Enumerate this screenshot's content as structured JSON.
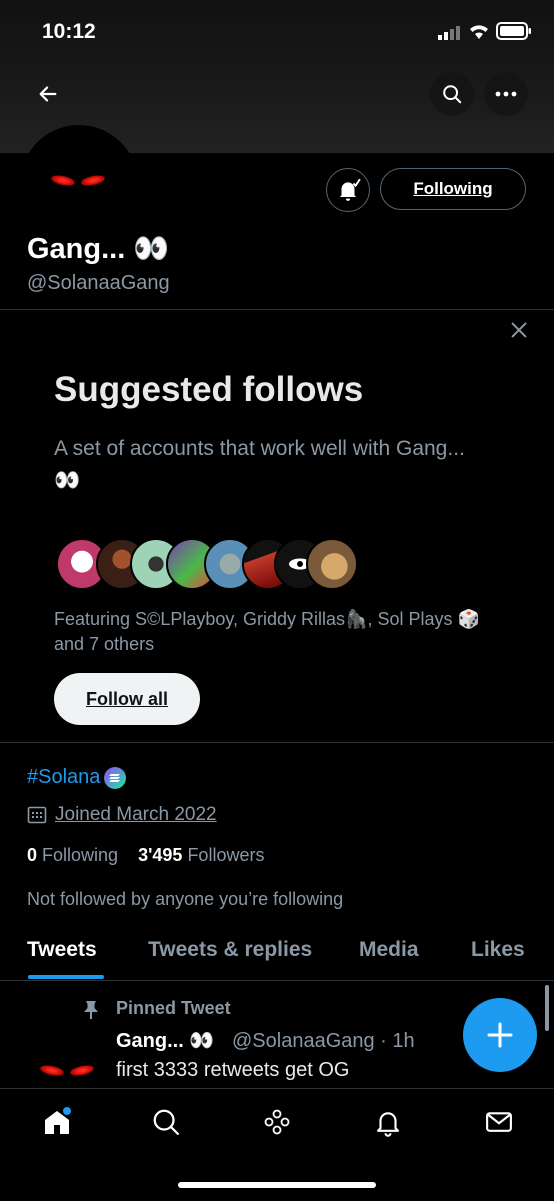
{
  "status_bar": {
    "time": "10:12"
  },
  "profile": {
    "name": "Gang... 👀",
    "handle": "@SolanaaGang",
    "following_button": "Following",
    "bio_hashtag": "#Solana",
    "joined": "Joined March 2022",
    "following_count": "0",
    "following_label": "Following",
    "followers_count": "3'495",
    "followers_label": "Followers",
    "not_followed_text": "Not followed by anyone you’re following"
  },
  "suggested": {
    "title": "Suggested follows",
    "description": "A set of accounts that work well with Gang... 👀",
    "featuring": "Featuring S©LPlayboy, Griddy Rillas🦍, Sol Plays 🎲 and 7 others",
    "follow_all": "Follow all",
    "avatar_colors": [
      "#e8e0e0",
      "#6b3a2a",
      "#9fd3b8",
      "#7b3fb0",
      "#5a8fb8",
      "#c0392b",
      "#111111",
      "#d4a96a"
    ]
  },
  "tabs": [
    "Tweets",
    "Tweets & replies",
    "Media",
    "Likes"
  ],
  "active_tab": "Tweets",
  "pinned_tweet": {
    "label": "Pinned Tweet",
    "author": "Gang... 👀",
    "meta": "@SolanaaGang · 1h",
    "text": "first 3333 retweets get OG"
  },
  "nav_icons": [
    "home-icon",
    "search-icon",
    "spaces-icon",
    "notifications-icon",
    "messages-icon"
  ],
  "colors": {
    "accent": "#1d9bf0",
    "background": "#000000",
    "muted": "#8b98a5"
  }
}
